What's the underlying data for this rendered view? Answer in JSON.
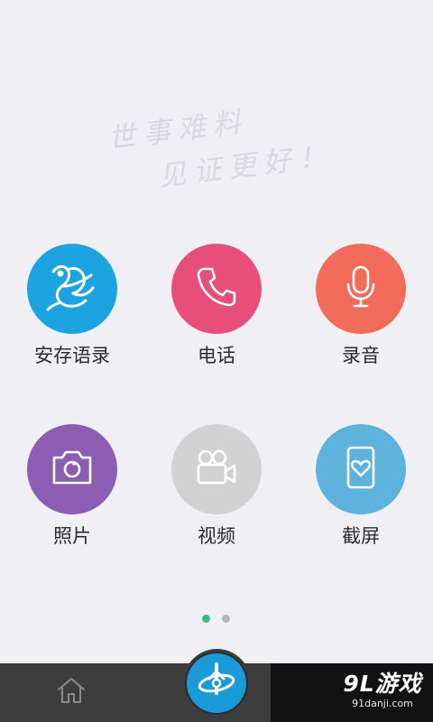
{
  "slogan": {
    "line1": "世事难料",
    "line2": "见证更好！"
  },
  "grid": [
    {
      "label": "安存语录",
      "color": "#1ba4e0",
      "icon": "bird-logo-icon"
    },
    {
      "label": "电话",
      "color": "#e74f7a",
      "icon": "phone-icon"
    },
    {
      "label": "录音",
      "color": "#f26b5b",
      "icon": "microphone-icon"
    },
    {
      "label": "照片",
      "color": "#8b5db3",
      "icon": "camera-icon"
    },
    {
      "label": "视频",
      "color": "#d2d2d2",
      "icon": "video-camera-icon"
    },
    {
      "label": "截屏",
      "color": "#5db3dc",
      "icon": "phone-heart-icon"
    }
  ],
  "pager": {
    "pages": 2,
    "current": 1,
    "active_color": "#2ec27e",
    "inactive_color": "#b4b4b4"
  },
  "bottom_bar": {
    "home_icon": "home-icon",
    "center_icon": "app-logo-icon",
    "watermark_brand": "9L游戏",
    "watermark_url": "91danji.com"
  }
}
